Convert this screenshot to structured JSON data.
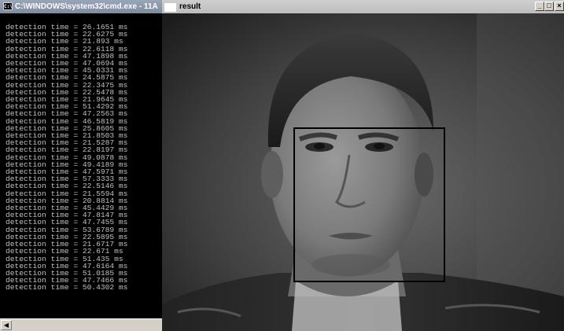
{
  "cmd_window": {
    "title": "C:\\WINDOWS\\system32\\cmd.exe - 11A",
    "icon_text": "C:\\",
    "lines": [
      "detection time = 26.1651 ms",
      "detection time = 22.6275 ms",
      "detection time = 21.893 ms",
      "detection time = 22.6118 ms",
      "detection time = 47.1898 ms",
      "detection time = 47.0694 ms",
      "detection time = 45.0331 ms",
      "detection time = 24.5875 ms",
      "detection time = 22.3475 ms",
      "detection time = 22.5478 ms",
      "detection time = 21.9645 ms",
      "detection time = 51.4292 ms",
      "detection time = 47.2563 ms",
      "detection time = 46.5819 ms",
      "detection time = 25.8605 ms",
      "detection time = 21.8503 ms",
      "detection time = 21.5287 ms",
      "detection time = 22.8197 ms",
      "detection time = 49.0878 ms",
      "detection time = 49.4189 ms",
      "detection time = 47.5971 ms",
      "detection time = 57.3333 ms",
      "detection time = 22.5146 ms",
      "detection time = 21.5594 ms",
      "detection time = 20.8814 ms",
      "detection time = 45.4429 ms",
      "detection time = 47.8147 ms",
      "detection time = 47.7455 ms",
      "detection time = 53.6789 ms",
      "detection time = 22.5895 ms",
      "detection time = 21.6717 ms",
      "detection time = 22.671 ms",
      "detection time = 51.435 ms",
      "detection time = 47.6164 ms",
      "detection time = 51.0185 ms",
      "detection time = 47.7466 ms",
      "detection time = 50.4302 ms"
    ],
    "scroll_left": "◀"
  },
  "result_window": {
    "title": "result",
    "minimize": "_",
    "maximize": "□",
    "close": "×"
  }
}
